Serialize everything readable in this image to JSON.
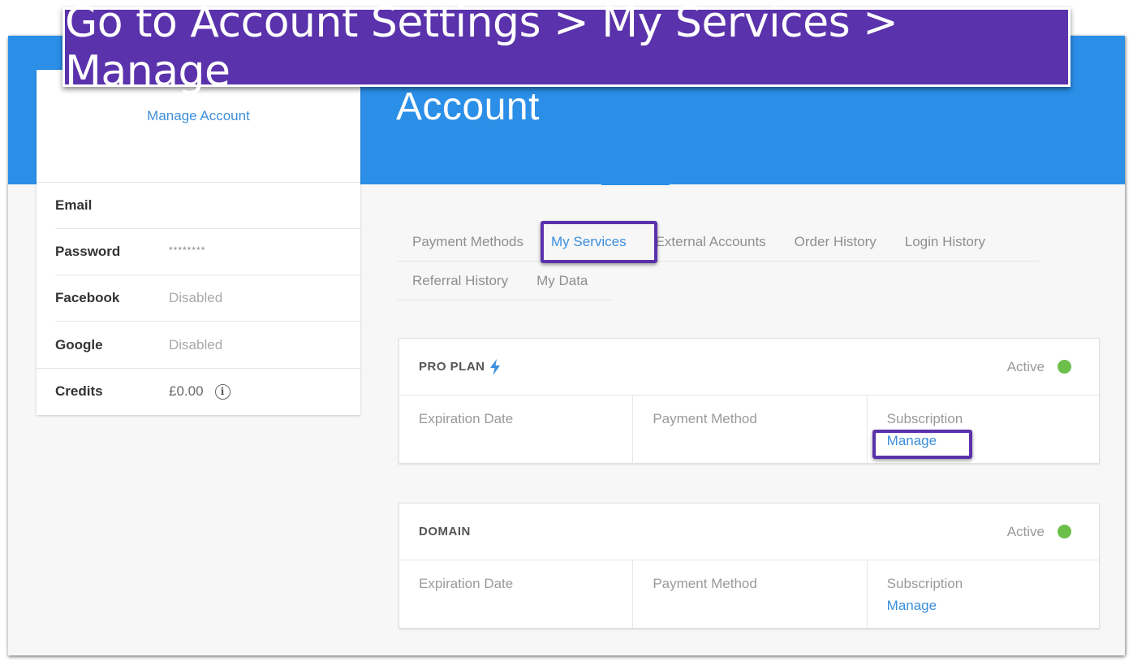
{
  "annotation": {
    "instruction": "Go to Account Settings > My Services > Manage",
    "highlight_color": "#5a32ab"
  },
  "header": {
    "title": "Account",
    "background_color": "#2b8fe8"
  },
  "sidebar": {
    "manage_account_link": "Manage Account",
    "rows": [
      {
        "label": "Email",
        "value": ""
      },
      {
        "label": "Password",
        "value": "********"
      },
      {
        "label": "Facebook",
        "value": "Disabled"
      },
      {
        "label": "Google",
        "value": "Disabled"
      },
      {
        "label": "Credits",
        "value": "£0.00",
        "icon": "info-icon"
      }
    ]
  },
  "tabs": {
    "items": [
      {
        "label": "Payment Methods",
        "active": false
      },
      {
        "label": "My Services",
        "active": true
      },
      {
        "label": "External Accounts",
        "active": false
      },
      {
        "label": "Order History",
        "active": false
      },
      {
        "label": "Login History",
        "active": false
      },
      {
        "label": "Referral History",
        "active": false
      },
      {
        "label": "My Data",
        "active": false
      }
    ]
  },
  "services": [
    {
      "name": "PRO PLAN",
      "icon": "lightning-bolt-icon",
      "status": "Active",
      "status_color": "#6cc04a",
      "columns": [
        {
          "label": "Expiration Date"
        },
        {
          "label": "Payment Method"
        },
        {
          "label": "Subscription",
          "link": "Manage"
        }
      ]
    },
    {
      "name": "DOMAIN",
      "status": "Active",
      "status_color": "#6cc04a",
      "columns": [
        {
          "label": "Expiration Date"
        },
        {
          "label": "Payment Method"
        },
        {
          "label": "Subscription",
          "link": "Manage"
        }
      ]
    }
  ]
}
